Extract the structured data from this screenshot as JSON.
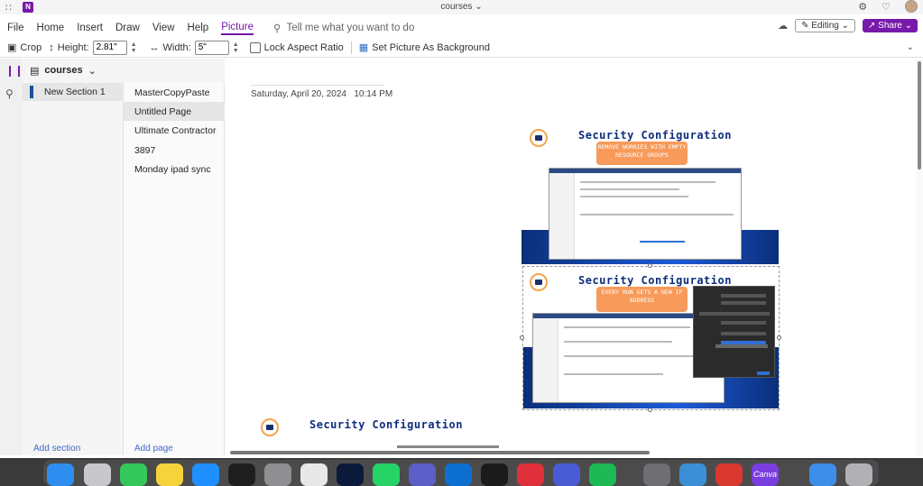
{
  "titlebar": {
    "title": "courses ⌄"
  },
  "menu": {
    "items": [
      "File",
      "Home",
      "Insert",
      "Draw",
      "View",
      "Help",
      "Picture"
    ],
    "tellme": "Tell me what you want to do",
    "editing": "Editing ⌄",
    "share": "Share ⌄"
  },
  "ribbon": {
    "crop": "Crop",
    "height_label": "Height:",
    "height_value": "2.81\"",
    "width_label": "Width:",
    "width_value": "5\"",
    "lock_aspect": "Lock Aspect Ratio",
    "set_background": "Set Picture As Background"
  },
  "notebook": {
    "name": "courses",
    "section": "New Section 1",
    "pages": [
      "MasterCopyPaste",
      "Untitled Page",
      "Ultimate Contractor",
      "3897",
      "Monday ipad sync"
    ],
    "add_section": "Add section",
    "add_page": "Add page"
  },
  "page": {
    "date": "Saturday, April 20, 2024",
    "time": "10:14 PM"
  },
  "slides": [
    {
      "title": "Security Configuration",
      "callout": "REMOVE WORRIES WITH EMPTY RESOURCE GROUPS"
    },
    {
      "title": "Security Configuration",
      "callout": "EVERY RUN GETS A NEW IP ADDRESS"
    },
    {
      "title": "Security Configuration"
    }
  ],
  "dock": {
    "canva_label": "Canva"
  },
  "colors": {
    "accent": "#7719aa",
    "link": "#4366c8",
    "brand_blue": "#0e2d7d",
    "callout": "#f79a5a"
  }
}
